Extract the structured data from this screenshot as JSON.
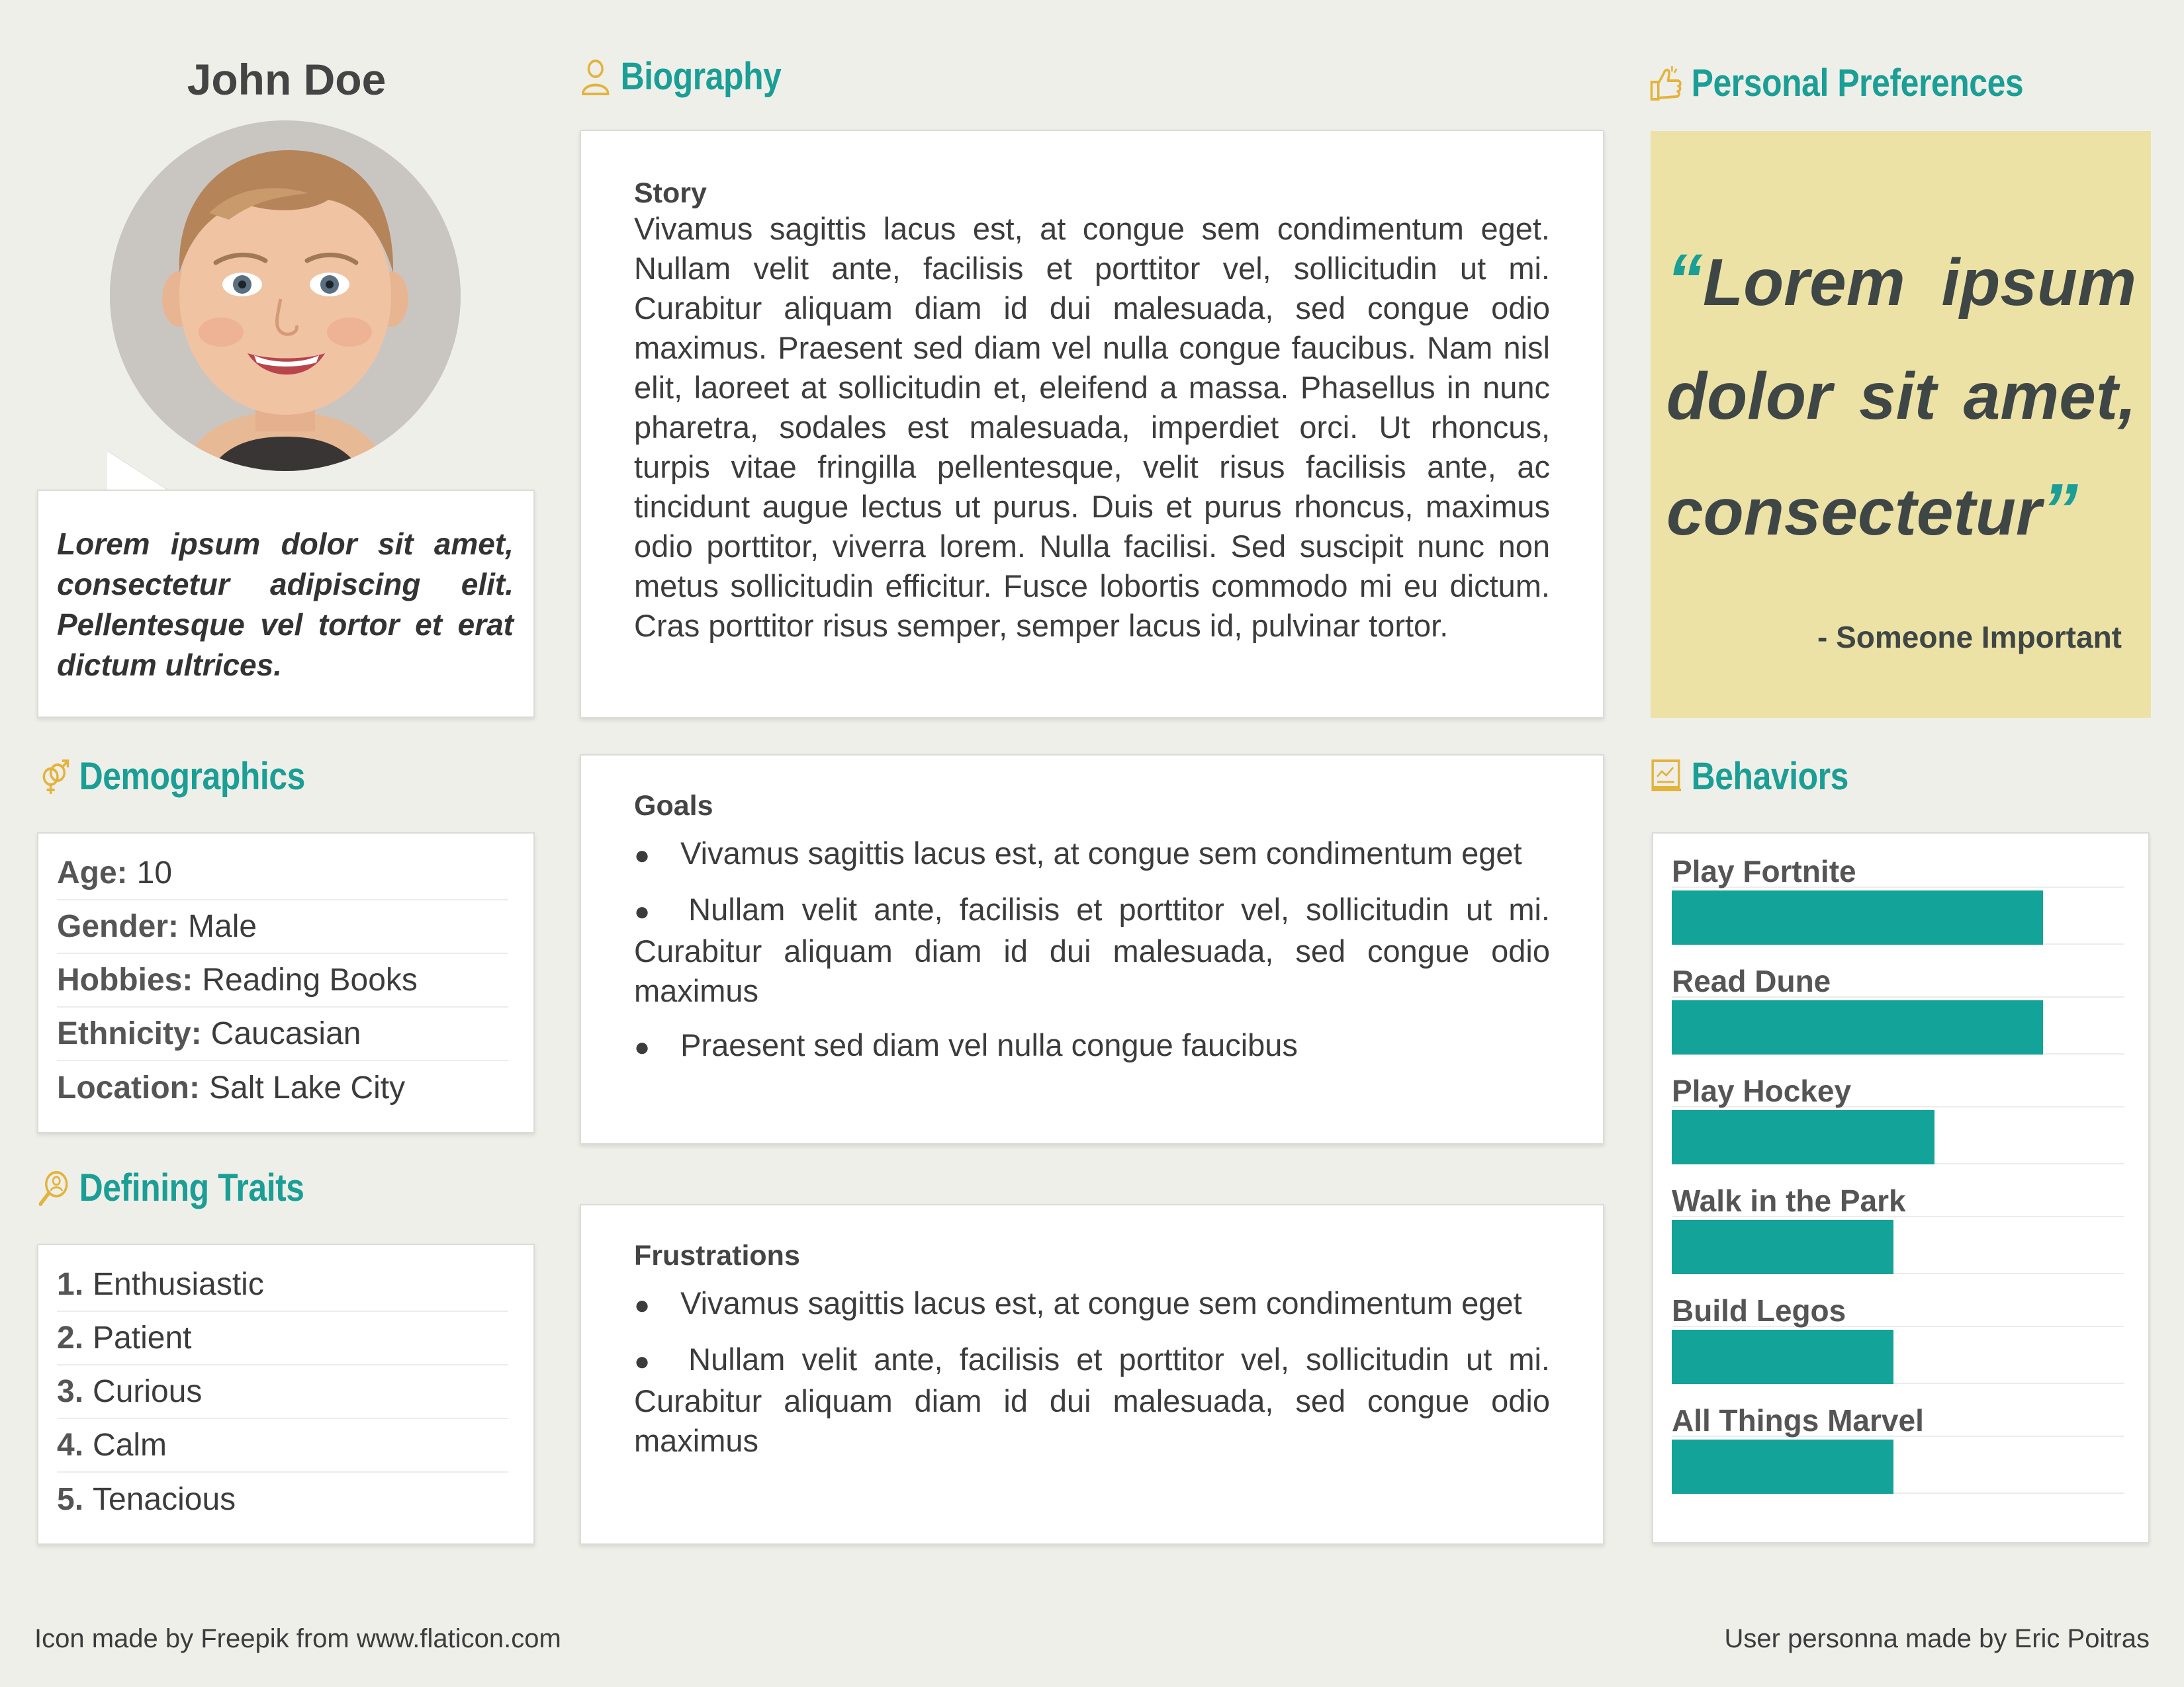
{
  "profile": {
    "name": "John Doe",
    "tagline": "Lorem ipsum dolor sit amet, consectetur adipiscing elit. Pellentesque vel tortor et erat dictum ultrices."
  },
  "demographics": {
    "title": "Demographics",
    "rows": [
      {
        "key": "Age:",
        "value": "10"
      },
      {
        "key": "Gender:",
        "value": "Male"
      },
      {
        "key": "Hobbies:",
        "value": "Reading Books"
      },
      {
        "key": "Ethnicity:",
        "value": "Caucasian"
      },
      {
        "key": "Location:",
        "value": "Salt Lake City"
      }
    ]
  },
  "traits": {
    "title": "Defining Traits",
    "rows": [
      {
        "key": "1.",
        "value": "Enthusiastic"
      },
      {
        "key": "2.",
        "value": "Patient"
      },
      {
        "key": "3.",
        "value": "Curious"
      },
      {
        "key": "4.",
        "value": "Calm"
      },
      {
        "key": "5.",
        "value": "Tenacious"
      }
    ]
  },
  "biography": {
    "title": "Biography",
    "story_label": "Story",
    "story": "Vivamus sagittis lacus est, at congue sem condimentum eget. Nullam velit ante, facilisis et porttitor vel, sollicitudin ut mi. Curabitur aliquam diam id dui malesuada, sed congue odio maximus. Praesent sed diam vel nulla congue faucibus. Nam nisl elit, laoreet at sollicitudin et, eleifend a massa. Phasellus in nunc pharetra, sodales est malesuada, imperdiet orci. Ut rhoncus, turpis vitae fringilla pellentesque, velit risus facilisis ante, ac tincidunt augue lectus ut purus. Duis et purus rhoncus, maximus odio porttitor, viverra lorem. Nulla facilisi. Sed suscipit nunc non metus sollicitudin efficitur. Fusce lobortis commodo mi eu dictum. Cras porttitor risus semper, semper lacus id, pulvinar tortor.",
    "goals_label": "Goals",
    "goals": [
      "Vivamus sagittis lacus est, at congue sem condimentum eget",
      "Nullam velit ante, facilisis et porttitor vel, sollicitudin ut mi. Curabitur aliquam diam id dui malesuada, sed congue odio maximus",
      "Praesent sed diam vel nulla congue faucibus"
    ],
    "frustrations_label": "Frustrations",
    "frustrations": [
      "Vivamus sagittis lacus est, at congue sem condimentum eget",
      "Nullam velit ante, facilisis et porttitor vel, sollicitudin ut mi. Curabitur aliquam diam id dui malesuada, sed congue odio maximus"
    ]
  },
  "preferences": {
    "title": "Personal Preferences",
    "quote": "Lorem ipsum dolor sit amet, consectetur",
    "author": "- Someone Important",
    "quote_color": "#1a9e95",
    "box_color": "#ede2a6"
  },
  "behaviors": {
    "title": "Behaviors",
    "bar_color": "#14a398",
    "items": [
      {
        "label": "Play Fortnite",
        "level": 0.82
      },
      {
        "label": "Read Dune",
        "level": 0.82
      },
      {
        "label": "Play Hockey",
        "level": 0.58
      },
      {
        "label": "Walk in the Park",
        "level": 0.49
      },
      {
        "label": "Build Legos",
        "level": 0.49
      },
      {
        "label": "All Things Marvel",
        "level": 0.49
      }
    ]
  },
  "icons": {
    "biography": "user-icon",
    "preferences": "thumbs-up-icon",
    "demographics": "gender-icon",
    "traits": "magnifier-user-icon",
    "behaviors": "chart-board-icon"
  },
  "footer": {
    "left": "Icon made by Freepik from www.flaticon.com",
    "right": "User personna made by Eric Poitras"
  }
}
